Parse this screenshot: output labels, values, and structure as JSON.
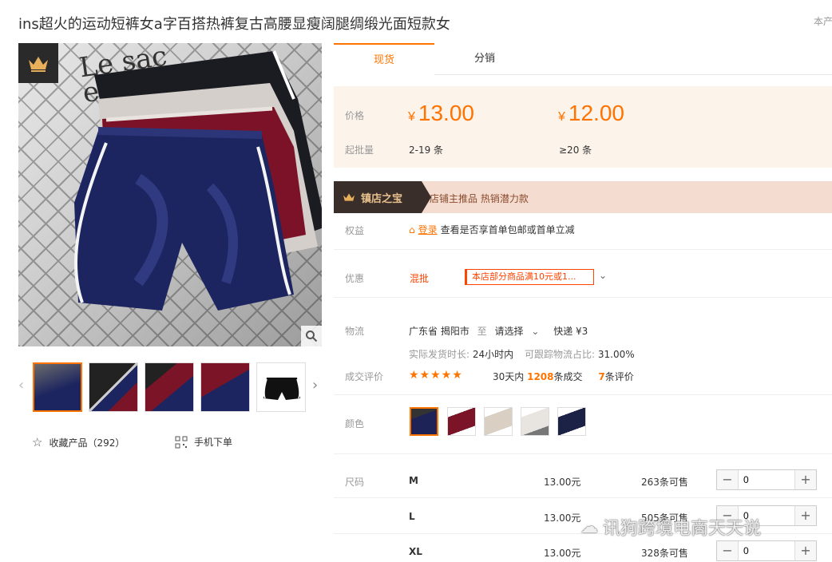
{
  "product": {
    "title": "ins超火的运动短裤女a字百搭热裤复古高腰显瘦阔腿绸缎光面短款女",
    "title_right": "本产"
  },
  "gallery": {
    "bg_text_line1": "Le sac",
    "bg_text_line2": "en papier",
    "thumbs": [
      "navy",
      "mixed",
      "burgundy",
      "burgundy-navy",
      "black"
    ],
    "selected_thumb": 0
  },
  "actions": {
    "favorite_label": "收藏产品（292）",
    "mobile_order_label": "手机下单"
  },
  "tabs": {
    "spot": "现货",
    "distribution": "分销"
  },
  "pricing": {
    "price_label": "价格",
    "moq_label": "起批量",
    "currency": "¥",
    "tier1_price": "13.00",
    "tier1_qty": "2-19 条",
    "tier2_price": "12.00",
    "tier2_qty": "≥20 条"
  },
  "promo": {
    "badge": "镇店之宝",
    "text": "店铺主推品  热销潜力款"
  },
  "rights": {
    "label": "权益",
    "tag": "登录",
    "text": "查看是否享首单包邮或首单立减"
  },
  "discount": {
    "label": "优惠",
    "type": "混批",
    "coupon": "本店部分商品满10元或1..."
  },
  "logistics": {
    "label": "物流",
    "origin": "广东省 揭阳市",
    "to": "至",
    "select": "请选择",
    "express": "快递 ¥3",
    "ship_time_label": "实际发货时长:",
    "ship_time": "24小时内",
    "trace_label": "可跟踪物流占比:",
    "trace_rate": "31.00%"
  },
  "deals": {
    "label": "成交评价",
    "rating": 4.5,
    "days": "30天内",
    "sold": "1208",
    "sold_suffix": "条成交",
    "reviews": "7",
    "reviews_suffix": "条评价"
  },
  "colors": {
    "label": "颜色",
    "options": [
      "#1d2257",
      "#7a1426",
      "#d9cfc2",
      "#e8e4e0",
      "#1c2146"
    ],
    "selected": 0
  },
  "sizes": {
    "label": "尺码",
    "rows": [
      {
        "name": "M",
        "price": "13.00元",
        "stock": "263条可售",
        "qty": "0"
      },
      {
        "name": "L",
        "price": "13.00元",
        "stock": "505条可售",
        "qty": "0"
      },
      {
        "name": "XL",
        "price": "13.00元",
        "stock": "328条可售",
        "qty": "0"
      }
    ]
  },
  "watermark": "讯狗跨境电商天天说",
  "colors_theme": {
    "accent": "#ff7300",
    "price_bg": "#fcf3eb",
    "promo_bg": "#f4dcd0"
  }
}
